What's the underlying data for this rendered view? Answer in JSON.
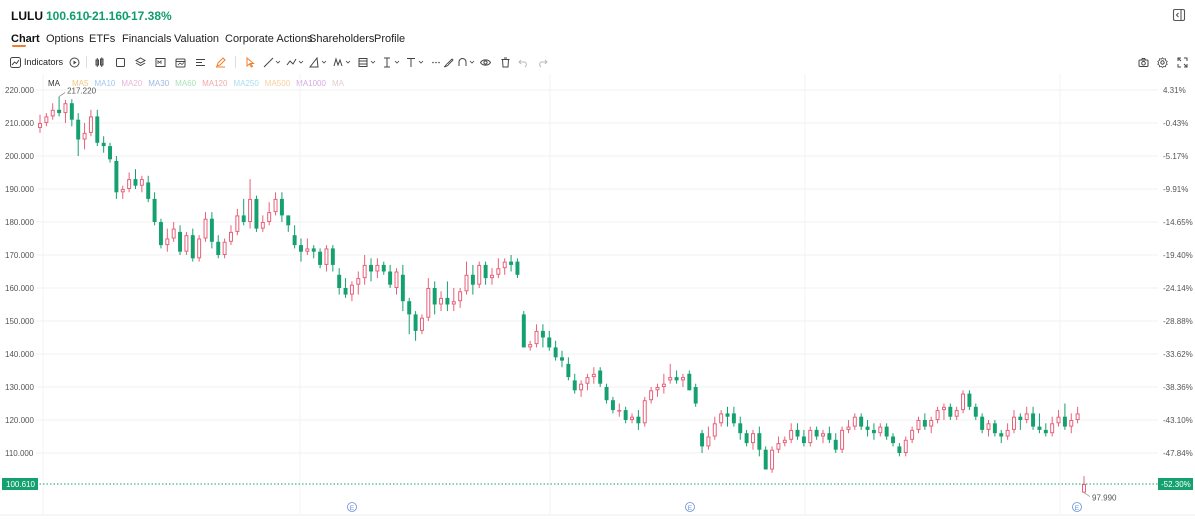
{
  "header": {
    "symbol": "LULU",
    "price": "100.610",
    "change": "-21.160",
    "change_pct": "-17.38%"
  },
  "tabs": [
    {
      "label": "Chart",
      "active": true
    },
    {
      "label": "Options"
    },
    {
      "label": "ETFs"
    },
    {
      "label": "Financials"
    },
    {
      "label": "Valuation"
    },
    {
      "label": "Corporate Actions"
    },
    {
      "label": "Shareholders"
    },
    {
      "label": "Profile"
    }
  ],
  "toolbar": {
    "indicators_label": "Indicators"
  },
  "ma_legend": {
    "label": "MA",
    "items": [
      {
        "name": "MA5",
        "color": "#f3c77d"
      },
      {
        "name": "MA10",
        "color": "#9ec9ee"
      },
      {
        "name": "MA20",
        "color": "#e8b6d8"
      },
      {
        "name": "MA30",
        "color": "#9fb9e3"
      },
      {
        "name": "MA60",
        "color": "#a8e3b8"
      },
      {
        "name": "MA120",
        "color": "#f2a9a9"
      },
      {
        "name": "MA250",
        "color": "#a7ddf0"
      },
      {
        "name": "MA500",
        "color": "#f6cf9c"
      },
      {
        "name": "MA1000",
        "color": "#d6a9e3"
      },
      {
        "name": "MA",
        "color": "#e2cfcf"
      }
    ]
  },
  "colors": {
    "up": "#e8617a",
    "down": "#14a06f",
    "accent": "#f07d2a"
  },
  "chart_data": {
    "type": "candlestick",
    "y_ticks": [
      "220.000",
      "210.000",
      "200.000",
      "190.000",
      "180.000",
      "170.000",
      "160.000",
      "150.000",
      "140.000",
      "130.000",
      "120.000",
      "110.000"
    ],
    "pct_ticks": [
      "4.31%",
      "-0.43%",
      "-5.17%",
      "-9.91%",
      "-14.65%",
      "-19.40%",
      "-24.14%",
      "-28.88%",
      "-33.62%",
      "-38.36%",
      "-43.10%",
      "-47.84%"
    ],
    "ylim": [
      97,
      223
    ],
    "current_price_label": "100.610",
    "current_pct_label": "-52.30%",
    "high_marker": "217.220",
    "low_marker": "97.990",
    "earnings_marker": "E",
    "earnings_marker_count": 3,
    "candles": [
      [
        208.5,
        212.5,
        207,
        210
      ],
      [
        210,
        213,
        209,
        212
      ],
      [
        212,
        216,
        211,
        214
      ],
      [
        214,
        218,
        212,
        213
      ],
      [
        213,
        217,
        210,
        216
      ],
      [
        216,
        217.2,
        209,
        211
      ],
      [
        211,
        213,
        200,
        205
      ],
      [
        205,
        210,
        202,
        207
      ],
      [
        207,
        214,
        206,
        212
      ],
      [
        212,
        214,
        203,
        204
      ],
      [
        204,
        206,
        201,
        203
      ],
      [
        203,
        204,
        198,
        199
      ],
      [
        198.5,
        200,
        187,
        189
      ],
      [
        189,
        191,
        187,
        190
      ],
      [
        190,
        195,
        189,
        193
      ],
      [
        193,
        196,
        190,
        191
      ],
      [
        191,
        194,
        189,
        193
      ],
      [
        192,
        194,
        186,
        187
      ],
      [
        187,
        189,
        179,
        180
      ],
      [
        180,
        181,
        172,
        173
      ],
      [
        173,
        178,
        171,
        175
      ],
      [
        175,
        180,
        174,
        178
      ],
      [
        177,
        179,
        170,
        171
      ],
      [
        171,
        177,
        170,
        176
      ],
      [
        176,
        178,
        168,
        169
      ],
      [
        169,
        176,
        168,
        175
      ],
      [
        175,
        183,
        174,
        181
      ],
      [
        181,
        183,
        172,
        174
      ],
      [
        174,
        176,
        169,
        170
      ],
      [
        170,
        175,
        169,
        174
      ],
      [
        174,
        179,
        173,
        177
      ],
      [
        177,
        184,
        176,
        182
      ],
      [
        182,
        187,
        179,
        180
      ],
      [
        180,
        193,
        178,
        187
      ],
      [
        187,
        188,
        177,
        178
      ],
      [
        178,
        182,
        177,
        180
      ],
      [
        180,
        186,
        179,
        183
      ],
      [
        183,
        189,
        182,
        187
      ],
      [
        187,
        189,
        180,
        182
      ],
      [
        182,
        182,
        177,
        179
      ],
      [
        176,
        179,
        172,
        173
      ],
      [
        173,
        175,
        168,
        171
      ],
      [
        171,
        175,
        170,
        172
      ],
      [
        172,
        173,
        169,
        171
      ],
      [
        171,
        172,
        166,
        167
      ],
      [
        167,
        173,
        165,
        172
      ],
      [
        172,
        173,
        165,
        167
      ],
      [
        164,
        166,
        158,
        160
      ],
      [
        160,
        163,
        157,
        158
      ],
      [
        158,
        162,
        156,
        161
      ],
      [
        161,
        165,
        158,
        163
      ],
      [
        163,
        170,
        161,
        167
      ],
      [
        167,
        169,
        162,
        165
      ],
      [
        165,
        169,
        163,
        167
      ],
      [
        167,
        168,
        164,
        165
      ],
      [
        165,
        167,
        160,
        161
      ],
      [
        160,
        166,
        158,
        165
      ],
      [
        164,
        167,
        153,
        156
      ],
      [
        156,
        157,
        146,
        152
      ],
      [
        152,
        153,
        144,
        147
      ],
      [
        147,
        152,
        146,
        151
      ],
      [
        151,
        163,
        150,
        160
      ],
      [
        160,
        162,
        152,
        155
      ],
      [
        155,
        159,
        153,
        157
      ],
      [
        157,
        162,
        153,
        155
      ],
      [
        155,
        160,
        153,
        156
      ],
      [
        156,
        160,
        154,
        159
      ],
      [
        159,
        168,
        158,
        164
      ],
      [
        164,
        167,
        158,
        161
      ],
      [
        161,
        168,
        160,
        167
      ],
      [
        167,
        168,
        161,
        163
      ],
      [
        163,
        166,
        161,
        164
      ],
      [
        164,
        169,
        163,
        166
      ],
      [
        166,
        169,
        164,
        168
      ],
      [
        168,
        170,
        165,
        167
      ],
      [
        168,
        169,
        163,
        164
      ],
      [
        152,
        153,
        142,
        142
      ],
      [
        142,
        144,
        141,
        143
      ],
      [
        143,
        149,
        142,
        147
      ],
      [
        147,
        149,
        142,
        145
      ],
      [
        145,
        147,
        141,
        142
      ],
      [
        142,
        144,
        138,
        139
      ],
      [
        139,
        141,
        136,
        138
      ],
      [
        137,
        139,
        132,
        133
      ],
      [
        132,
        134,
        128,
        129
      ],
      [
        129,
        132,
        127,
        131
      ],
      [
        131,
        134,
        129,
        133
      ],
      [
        133,
        136,
        131,
        134
      ],
      [
        135,
        136,
        130,
        131
      ],
      [
        130,
        131,
        125,
        126
      ],
      [
        126,
        127,
        122,
        123
      ],
      [
        123,
        125,
        121,
        123
      ],
      [
        123,
        124,
        119,
        120
      ],
      [
        120,
        122,
        119,
        121
      ],
      [
        121,
        123,
        117,
        119
      ],
      [
        119,
        127,
        118,
        126
      ],
      [
        126,
        130,
        125,
        129
      ],
      [
        129,
        131,
        127,
        130
      ],
      [
        130,
        134,
        128,
        131
      ],
      [
        132,
        137,
        131,
        133
      ],
      [
        133,
        135,
        131,
        132
      ],
      [
        132,
        134,
        130,
        133
      ],
      [
        134,
        135,
        129,
        129
      ],
      [
        130,
        131,
        124,
        125
      ],
      [
        116,
        117,
        110,
        112
      ],
      [
        112,
        118,
        111,
        115
      ],
      [
        115,
        121,
        114,
        119
      ],
      [
        119,
        123,
        118,
        122
      ],
      [
        122,
        124,
        118,
        121
      ],
      [
        122,
        124,
        118,
        119
      ],
      [
        119,
        121,
        114,
        116
      ],
      [
        116,
        117,
        112,
        113
      ],
      [
        113,
        117,
        111,
        116
      ],
      [
        116,
        118,
        109,
        111
      ],
      [
        111,
        112,
        105,
        105
      ],
      [
        105,
        112,
        104,
        111
      ],
      [
        111,
        115,
        110,
        113
      ],
      [
        113,
        115,
        112,
        114
      ],
      [
        114,
        119,
        113,
        117
      ],
      [
        117,
        119,
        114,
        115
      ],
      [
        115,
        117,
        112,
        113
      ],
      [
        113,
        118,
        112,
        117
      ],
      [
        117,
        118,
        114,
        115
      ],
      [
        115,
        117,
        113,
        116
      ],
      [
        116,
        118,
        113,
        114
      ],
      [
        114,
        116,
        110,
        111
      ],
      [
        111,
        118,
        110,
        117
      ],
      [
        117,
        120,
        116,
        118
      ],
      [
        118,
        122,
        117,
        121
      ],
      [
        121,
        122,
        117,
        118
      ],
      [
        118,
        120,
        115,
        117
      ],
      [
        117,
        119,
        114,
        116
      ],
      [
        116,
        119,
        115,
        118
      ],
      [
        118,
        119,
        114,
        115
      ],
      [
        115,
        116,
        112,
        113
      ],
      [
        112,
        113,
        109,
        110
      ],
      [
        110,
        115,
        109,
        114
      ],
      [
        114,
        118,
        113,
        117
      ],
      [
        117,
        121,
        116,
        120
      ],
      [
        120,
        122,
        117,
        118
      ],
      [
        118,
        121,
        116,
        120
      ],
      [
        120,
        124,
        119,
        123
      ],
      [
        123,
        125,
        120,
        124
      ],
      [
        124,
        125,
        120,
        121
      ],
      [
        121,
        124,
        120,
        123
      ],
      [
        123,
        129,
        122,
        128
      ],
      [
        128,
        129,
        123,
        124
      ],
      [
        124,
        125,
        120,
        121
      ],
      [
        121,
        122,
        116,
        117
      ],
      [
        117,
        120,
        115,
        119
      ],
      [
        119,
        120,
        115,
        116
      ],
      [
        116,
        117,
        113,
        115
      ],
      [
        115,
        119,
        114,
        117
      ],
      [
        117,
        123,
        116,
        121
      ],
      [
        121,
        122,
        117,
        120
      ],
      [
        120,
        124,
        119,
        122
      ],
      [
        122,
        124,
        117,
        118
      ],
      [
        118,
        122,
        116,
        117
      ],
      [
        117,
        119,
        115,
        116
      ],
      [
        116,
        121,
        115,
        119
      ],
      [
        119,
        123,
        118,
        121
      ],
      [
        121,
        125,
        117,
        118
      ],
      [
        118,
        122,
        116,
        120
      ],
      [
        120,
        124,
        119,
        122
      ],
      [
        98,
        103,
        97.99,
        100.61
      ]
    ]
  }
}
